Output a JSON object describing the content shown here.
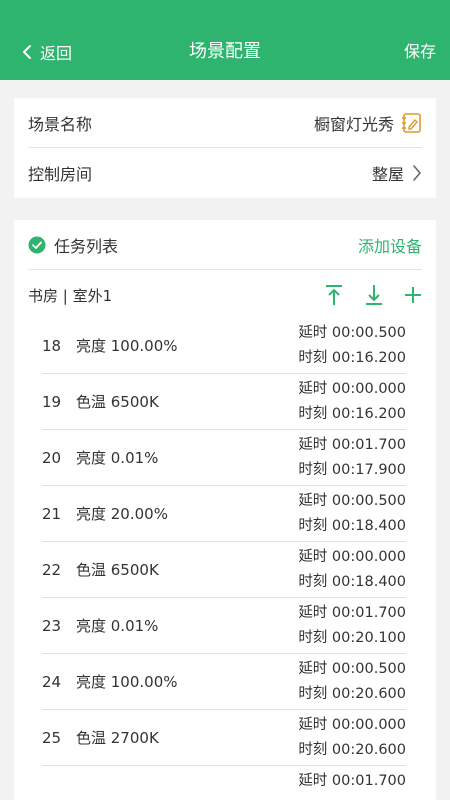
{
  "header": {
    "back_label": "返回",
    "title": "场景配置",
    "save_label": "保存"
  },
  "scene": {
    "name_label": "场景名称",
    "name_value": "橱窗灯光秀",
    "room_label": "控制房间",
    "room_value": "整屋"
  },
  "tasks": {
    "title": "任务列表",
    "add_device": "添加设备",
    "room": "书房 | 室外1",
    "items": [
      {
        "num": "18",
        "desc": "亮度 100.00%",
        "delay": "延时 00:00.500",
        "time": "时刻 00:16.200"
      },
      {
        "num": "19",
        "desc": "色温 6500K",
        "delay": "延时 00:00.000",
        "time": "时刻 00:16.200"
      },
      {
        "num": "20",
        "desc": "亮度 0.01%",
        "delay": "延时 00:01.700",
        "time": "时刻 00:17.900"
      },
      {
        "num": "21",
        "desc": "亮度 20.00%",
        "delay": "延时 00:00.500",
        "time": "时刻 00:18.400"
      },
      {
        "num": "22",
        "desc": "色温 6500K",
        "delay": "延时 00:00.000",
        "time": "时刻 00:18.400"
      },
      {
        "num": "23",
        "desc": "亮度 0.01%",
        "delay": "延时 00:01.700",
        "time": "时刻 00:20.100"
      },
      {
        "num": "24",
        "desc": "亮度 100.00%",
        "delay": "延时 00:00.500",
        "time": "时刻 00:20.600"
      },
      {
        "num": "25",
        "desc": "色温 2700K",
        "delay": "延时 00:00.000",
        "time": "时刻 00:20.600"
      },
      {
        "num": "",
        "desc": "",
        "delay": "延时 00:01.700",
        "time": ""
      }
    ]
  },
  "colors": {
    "accent": "#2fb46f",
    "edit_icon": "#e39a2b"
  }
}
